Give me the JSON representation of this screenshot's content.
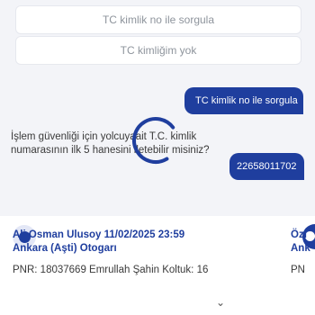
{
  "buttons": {
    "query_by_tc": "TC kimlik no ile sorgula",
    "no_tc": "TC kimliğim yok"
  },
  "chat": {
    "user_bubble": "TC kimlik no ile sorgula",
    "bot_question": "İşlem güvenliği için yolcuyaait T.C. kimlik numarasının ilk 5 hanesini iletebilir misiniz?",
    "user_reply": "22658011702"
  },
  "ticket": {
    "line1": "Ali Osman Ulusoy 11/02/2025 23:59",
    "line2": "Ankara (Aşti) Otogarı",
    "pnr_line": "PNR: 18037669 Emrullah Şahin Koltuk: 16",
    "right_line1": "Özl",
    "right_line2": "Ank",
    "right_pnr": "PN"
  },
  "colors": {
    "primary": "#1f3e9e",
    "background": "#f3f4f8",
    "spinner": "#1f3e9e"
  },
  "icons": {
    "spinner": "loading-spinner-icon",
    "chevron": "chevron-down-icon"
  }
}
